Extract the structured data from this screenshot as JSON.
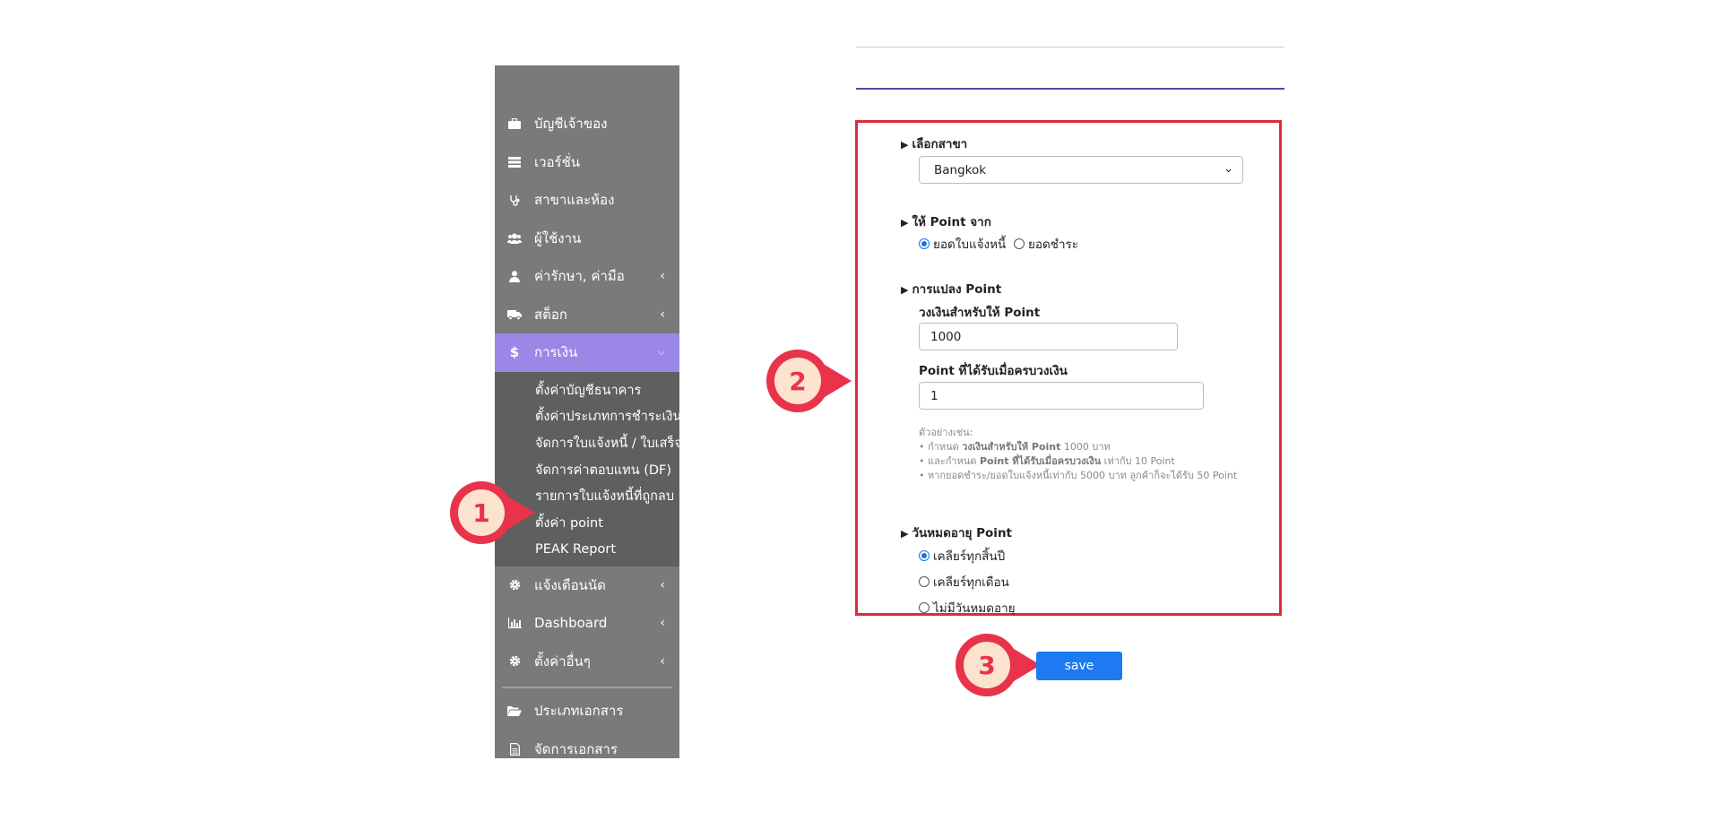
{
  "sidebar": {
    "items": [
      {
        "label": "บัญชีเจ้าของ",
        "icon": "briefcase-icon"
      },
      {
        "label": "เวอร์ชั่น",
        "icon": "list-icon"
      },
      {
        "label": "สาขาและห้อง",
        "icon": "stethoscope-icon"
      },
      {
        "label": "ผู้ใช้งาน",
        "icon": "users-icon"
      },
      {
        "label": "ค่ารักษา, ค่ามือ",
        "icon": "doctor-icon"
      },
      {
        "label": "สต็อก",
        "icon": "truck-icon"
      },
      {
        "label": "การเงิน",
        "icon": "dollar-icon"
      }
    ],
    "finance_submenu": [
      "ตั้งค่าบัญชีธนาคาร",
      "ตั้งค่าประเภทการชำระเงิน",
      "จัดการใบแจ้งหนี้ / ใบเสร็จ",
      "จัดการค่าตอบแทน (DF)",
      "รายการใบแจ้งหนี้ที่ถูกลบ",
      "ตั้งค่า point",
      "PEAK Report"
    ],
    "items_after": [
      {
        "label": "แจ้งเตือนนัด",
        "icon": "gear-icon"
      },
      {
        "label": "Dashboard",
        "icon": "bar-chart-icon"
      },
      {
        "label": "ตั้งค่าอื่นๆ",
        "icon": "gear-icon"
      }
    ],
    "items_bottom": [
      {
        "label": "ประเภทเอกสาร",
        "icon": "folder-open-icon"
      },
      {
        "label": "จัดการเอกสาร",
        "icon": "document-icon"
      }
    ]
  },
  "callouts": {
    "one": "1",
    "two": "2",
    "three": "3"
  },
  "form": {
    "branch": {
      "title": "เลือกสาขา",
      "selected": "Bangkok"
    },
    "point_source": {
      "title": "ให้ Point จาก",
      "option1": "ยอดใบแจ้งหนี้",
      "option2": "ยอดชำระ"
    },
    "conversion": {
      "title": "การแปลง Point",
      "amount_label": "วงเงินสำหรับให้ Point",
      "amount_value": "1000",
      "points_label": "Point ที่ได้รับเมื่อครบวงเงิน",
      "points_value": "1"
    },
    "example": {
      "heading": "ตัวอย่างเช่น:",
      "line1_prefix": "• กำหนด ",
      "line1_bold": "วงเงินสำหรับให้ Point",
      "line1_suffix": " 1000 บาท",
      "line2_prefix": "• และกำหนด ",
      "line2_bold": "Point ที่ได้รับเมื่อครบวงเงิน",
      "line2_suffix": " เท่ากับ 10 Point",
      "line3": "• หากยอดชำระ/ยอดใบแจ้งหนี้เท่ากับ 5000 บาท ลูกค้าก็จะได้รับ 50 Point"
    },
    "expiry": {
      "title": "วันหมดอายุ Point",
      "option1": "เคลียร์ทุกสิ้นปี",
      "option2": "เคลียร์ทุกเดือน",
      "option3": "ไม่มีวันหมดอายุ"
    }
  },
  "save_label": "save",
  "colors": {
    "accent": "#9b87e6",
    "highlight": "#e02a3a",
    "button": "#1d7af0",
    "callout": "#e8334a",
    "callout_fill": "#fbe3cf"
  }
}
